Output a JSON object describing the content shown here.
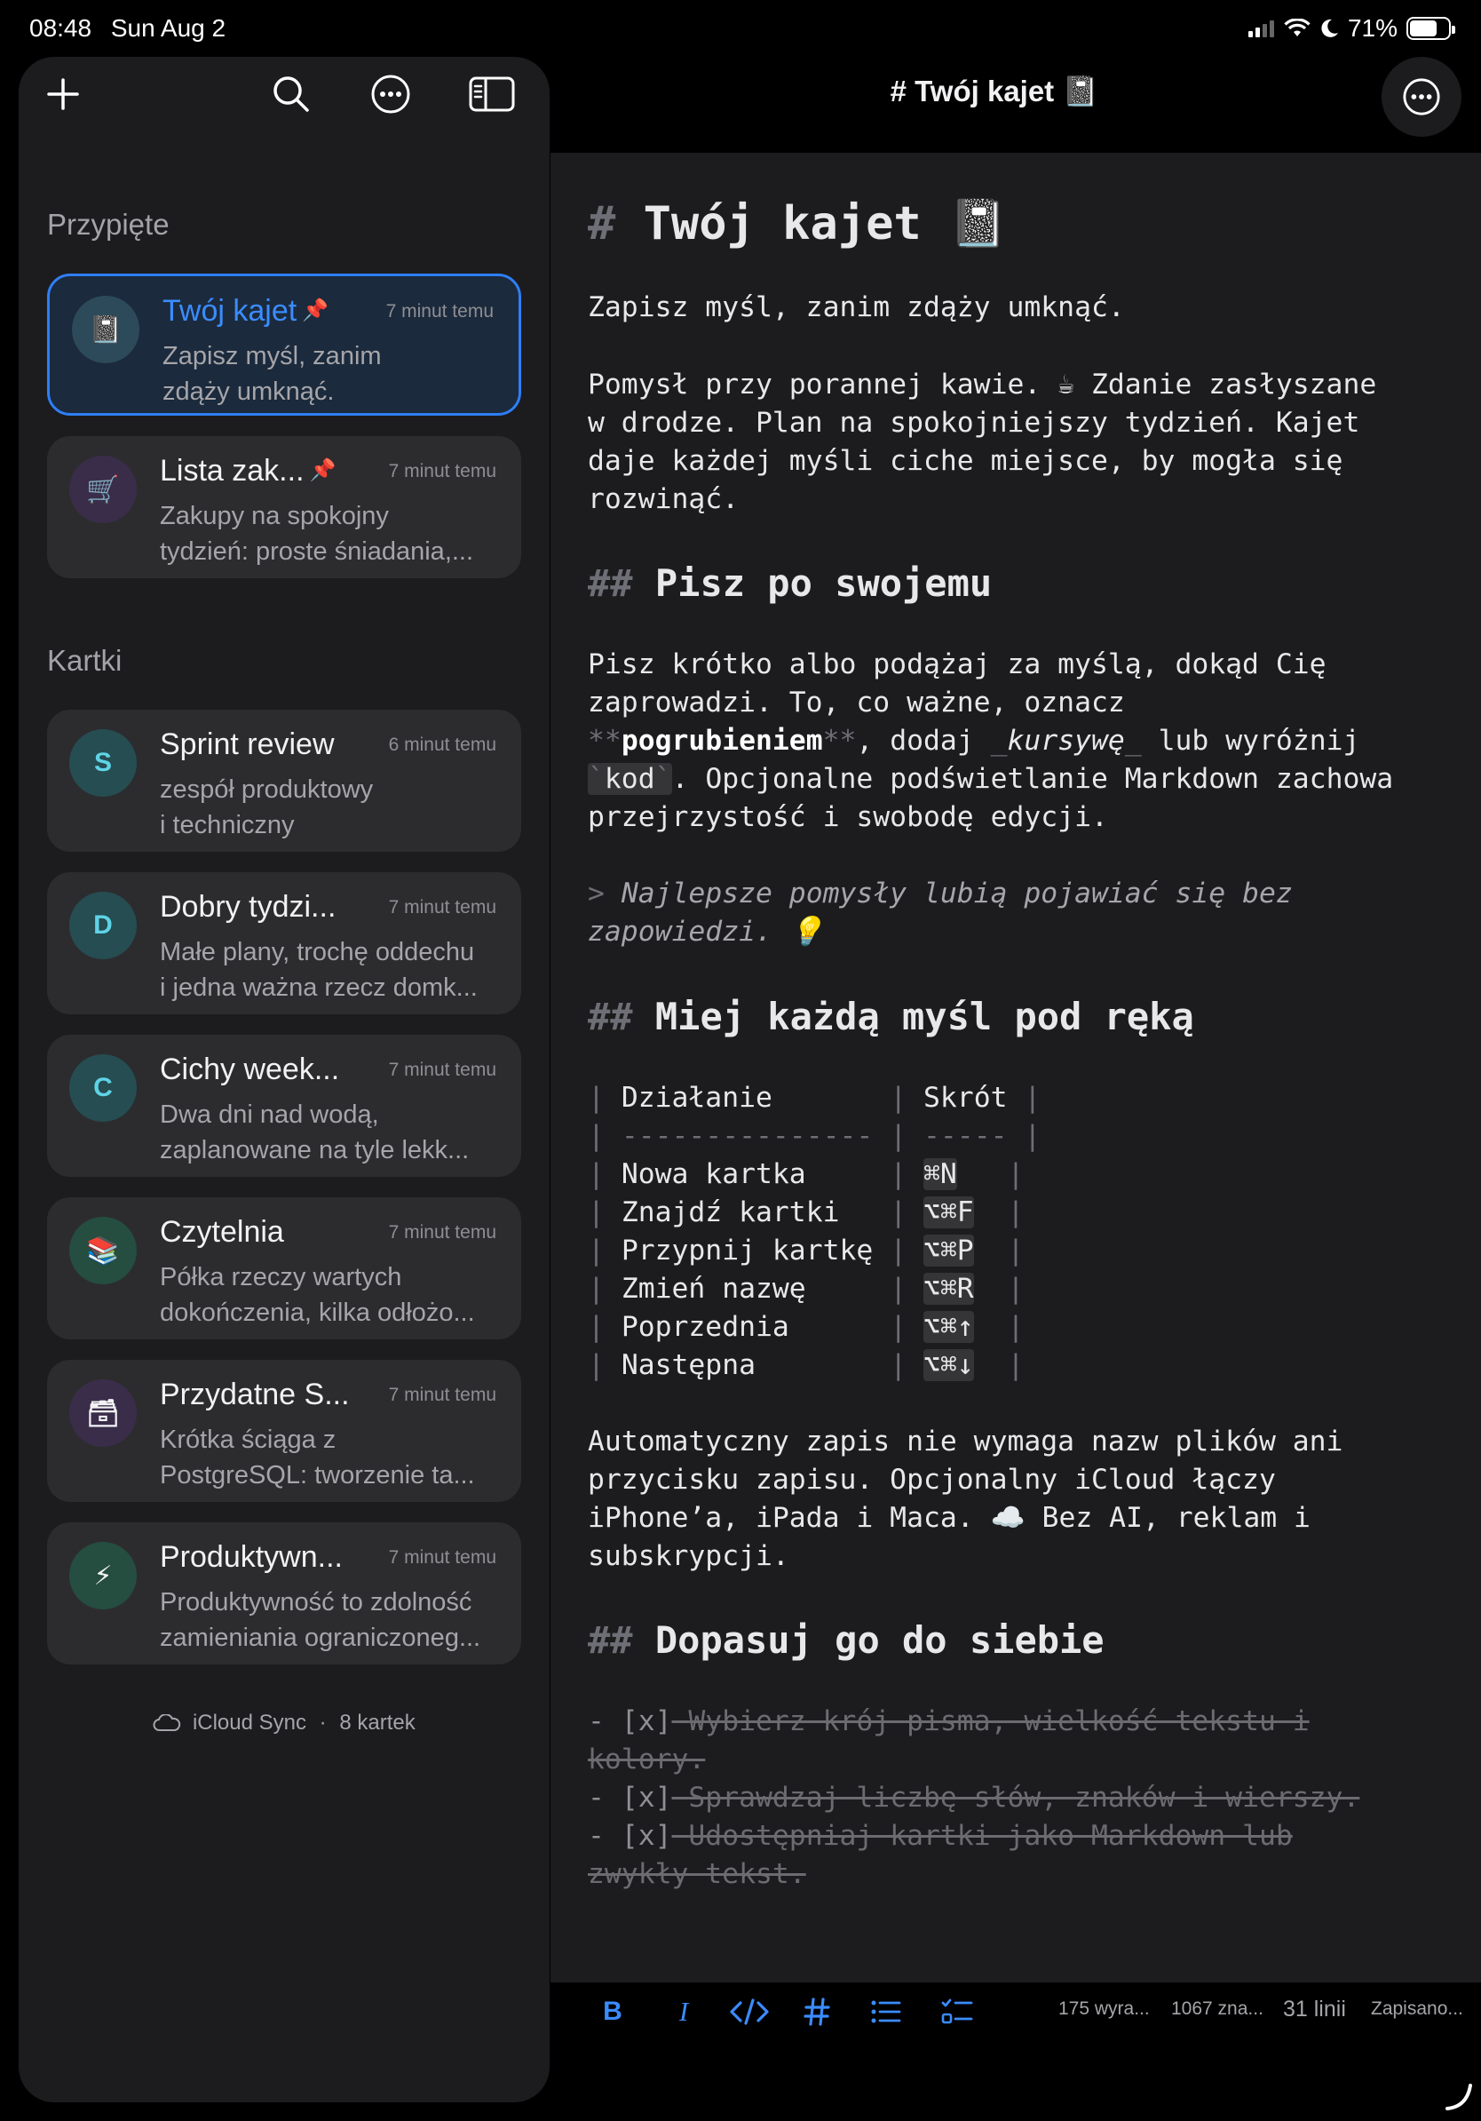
{
  "status_bar": {
    "time": "08:48",
    "date": "Sun Aug 2",
    "battery": "71%",
    "battery_level": 0.71
  },
  "sidebar": {
    "pinned_title": "Przypięte",
    "notes_title": "Kartki",
    "pinned": [
      {
        "title": "Twój kajet",
        "time": "7 minut temu",
        "snippet": [
          "Zapisz myśl, zanim",
          "zdąży umknąć."
        ],
        "avatar": "📓",
        "avatar_bg": "#2c4a5a",
        "pinned": "📌",
        "selected": true
      },
      {
        "title": "Lista zak...",
        "time": "7 minut temu",
        "snippet": [
          "Zakupy na spokojny",
          "tydzień: proste śniadania,..."
        ],
        "avatar": "🛒",
        "avatar_bg": "#3a2d4a",
        "pinned": "📌",
        "selected": false
      }
    ],
    "notes": [
      {
        "title": "Sprint review",
        "time": "6 minut temu",
        "snippet": [
          "zespół produktowy",
          "i techniczny"
        ],
        "avatar": "S",
        "avatar_bg": "#254d52",
        "avatar_color": "#5fd3e6"
      },
      {
        "title": "Dobry tydzi...",
        "time": "7 minut temu",
        "snippet": [
          "Małe plany, trochę oddechu",
          "i jedna ważna rzecz domk..."
        ],
        "avatar": "D",
        "avatar_bg": "#254d52",
        "avatar_color": "#5fd3e6"
      },
      {
        "title": "Cichy week...",
        "time": "7 minut temu",
        "snippet": [
          "Dwa dni nad wodą,",
          "zaplanowane na tyle lekk..."
        ],
        "avatar": "C",
        "avatar_bg": "#254d52",
        "avatar_color": "#5fd3e6"
      },
      {
        "title": "Czytelnia",
        "time": "7 minut temu",
        "snippet": [
          "Półka rzeczy wartych",
          "dokończenia, kilka odłożo..."
        ],
        "avatar": "📚",
        "avatar_bg": "#254d40",
        "avatar_color": "#fff"
      },
      {
        "title": "Przydatne S...",
        "time": "7 minut temu",
        "snippet": [
          "Krótka ściąga z",
          "PostgreSQL: tworzenie ta..."
        ],
        "avatar": "🗃",
        "avatar_bg": "#3a2d4a",
        "avatar_color": "#fff"
      },
      {
        "title": "Produktywn...",
        "time": "7 minut temu",
        "snippet": [
          "Produktywność to zdolność",
          "zamieniania ograniczoneg..."
        ],
        "avatar": "⚡",
        "avatar_bg": "#254d40",
        "avatar_color": "#fff"
      }
    ],
    "footer_sync": "iCloud Sync",
    "footer_sep": "·",
    "footer_count": "8 kartek"
  },
  "editor": {
    "header_title": "# Twój kajet 📓",
    "h1_mark": "#",
    "h1_text": "Twój kajet",
    "h1_emoji": "📓",
    "p1": "Zapisz myśl, zanim zdąży umknąć.",
    "p2": [
      "Pomysł przy porannej kawie. ☕ Zdanie zasłyszane",
      "w drodze. Plan na spokojniejszy tydzień. Kajet",
      "daje każdej myśli ciche miejsce, by mogła się",
      "rozwinąć."
    ],
    "h2_mark": "##",
    "h2a": "Pisz po swojemu",
    "p3_l1": "Pisz krótko albo podążaj za myślą, dokąd Cię",
    "p3_l2": "zaprowadzi. To, co ważne, oznacz",
    "p3_l3_bold_mk": "**",
    "p3_l3_bold": "pogrubieniem",
    "p3_l3_mid": ", dodaj ",
    "p3_l3_it_mk": "_",
    "p3_l3_it": "kursywę",
    "p3_l3_end": " lub wyróżnij",
    "p3_l4_code_mk": "`",
    "p3_l4_code": "kod",
    "p3_l4_end": ". Opcjonalne podświetlanie Markdown zachowa",
    "p3_l5": "przejrzystość i swobodę edycji.",
    "quote_mk": ">",
    "quote_l1": "Najlepsze pomysły lubią pojawiać się bez",
    "quote_l2": "zapowiedzi. 💡",
    "h2b": "Miej każdą myśl pod ręką",
    "table_header_a": "Działanie",
    "table_header_b": "Skrót",
    "table_sep_a": "---------------",
    "table_sep_b": "-----",
    "table_rows": [
      {
        "action": "Nowa kartka",
        "key": "⌘N"
      },
      {
        "action": "Znajdź kartki",
        "key": "⌥⌘F"
      },
      {
        "action": "Przypnij kartkę",
        "key": "⌥⌘P"
      },
      {
        "action": "Zmień nazwę",
        "key": "⌥⌘R"
      },
      {
        "action": "Poprzednia",
        "key": "⌥⌘↑"
      },
      {
        "action": "Następna",
        "key": "⌥⌘↓"
      }
    ],
    "p4": [
      "Automatyczny zapis nie wymaga nazw plików ani",
      "przycisku zapisu. Opcjonalny iCloud łączy",
      "iPhone’a, iPada i Maca. ☁️ Bez AI, reklam i",
      "subskrypcji."
    ],
    "h2c": "Dopasuj go do siebie",
    "task_mark": "- [x]",
    "tasks": [
      [
        "Wybierz krój pisma, wielkość tekstu i",
        "kolory."
      ],
      [
        "Sprawdzaj liczbę słów, znaków i wierszy."
      ],
      [
        "Udostępniaj kartki jako Markdown lub",
        "zwykły tekst."
      ]
    ]
  },
  "format_bar": {
    "bold": "B",
    "italic": "I",
    "words": "175 wyra...",
    "chars": "1067 zna...",
    "lines": "31 linii",
    "saved": "Zapisano..."
  },
  "colors": {
    "accent": "#3b8cff",
    "pin": "#f0a030"
  }
}
